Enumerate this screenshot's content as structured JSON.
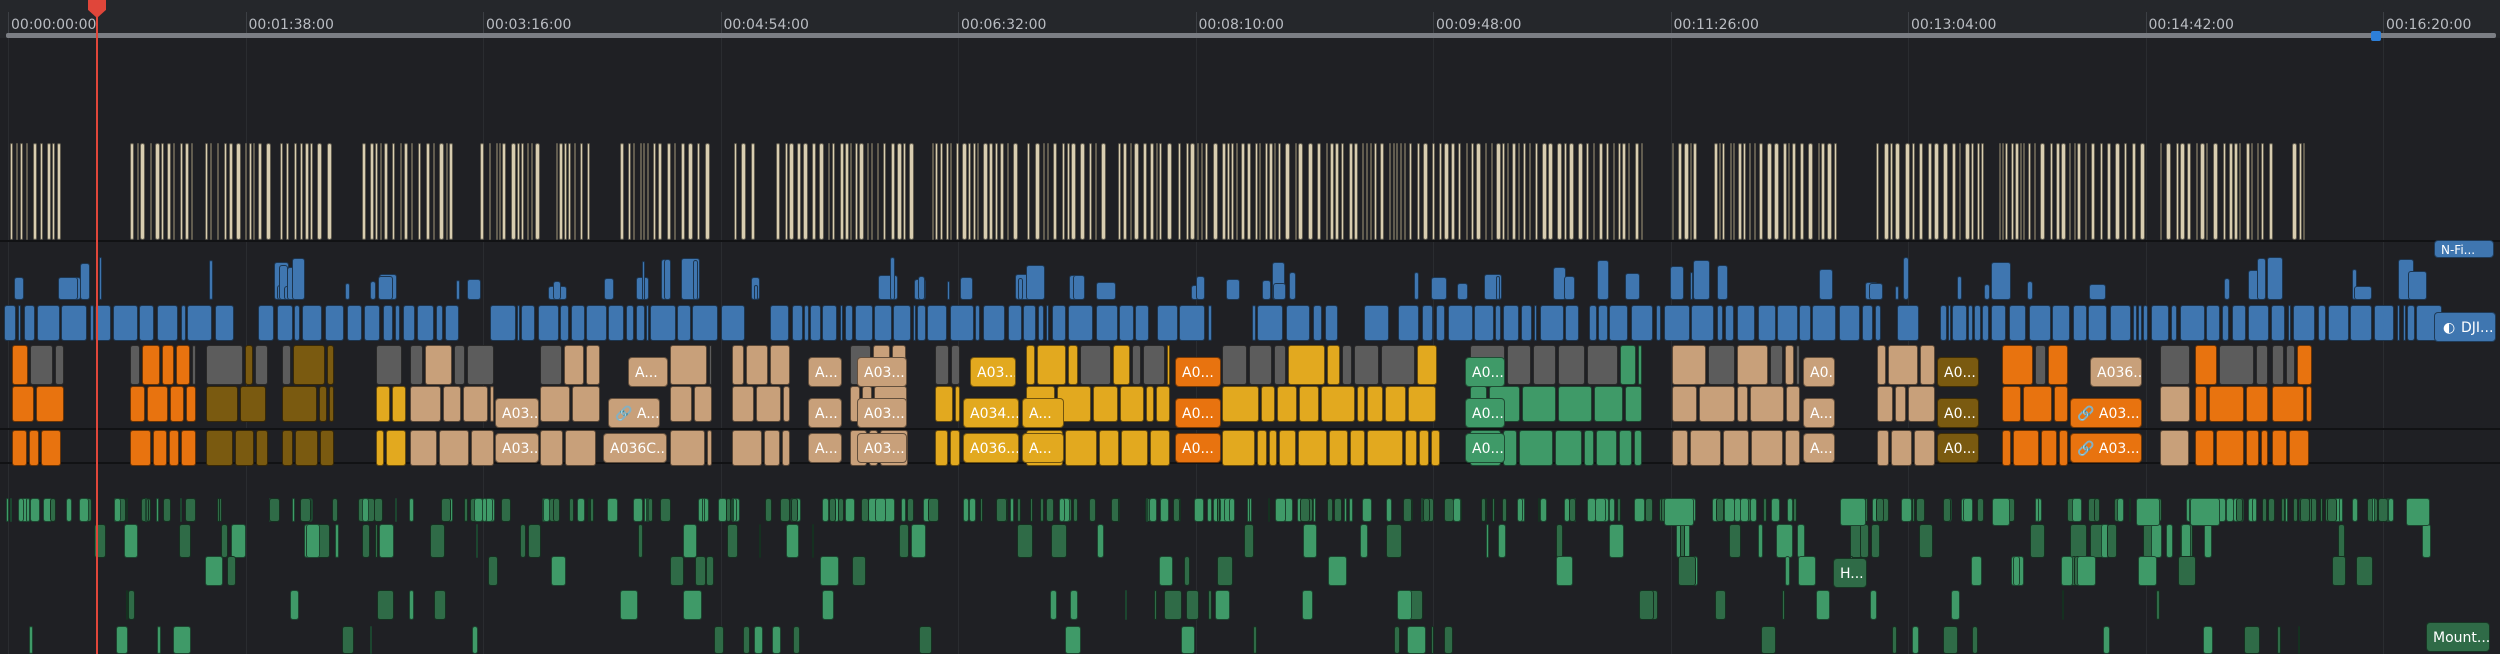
{
  "timecodes": [
    "00:00:00:00",
    "00:01:38:00",
    "00:03:16:00",
    "00:04:54:00",
    "00:06:32:00",
    "00:08:10:00",
    "00:09:48:00",
    "00:11:26:00",
    "00:13:04:00",
    "00:14:42:00",
    "00:16:20:00"
  ],
  "colors": {
    "cream": "#d8cdb0",
    "blue": "#3f76b0",
    "tan": "#c8a07a",
    "orange": "#e8730f",
    "yellow": "#e2a91f",
    "olive": "#7a5a10",
    "green": "#3f9a68",
    "darkgreen": "#2f6b47",
    "gray": "#5c5c5c",
    "playhead": "#e0463a"
  },
  "labels": {
    "v_right_top": "N-Fi...",
    "v_right_dji": "DJI...",
    "a1": "A...",
    "a2": "A...",
    "a3": "A03...",
    "a4": "A03...",
    "a5": "A0...",
    "a6": "A0...",
    "a7": "A0...",
    "a8": "A0...",
    "a9": "A036...",
    "b1": "A03...",
    "b2": "A...",
    "b3": "A...",
    "b4": "A03...",
    "b5": "A034...",
    "b6": "A...",
    "b7": "A0...",
    "b8": "A0...",
    "b9": "A...",
    "b10": "A0...",
    "b11": "A03...",
    "c1": "A03...",
    "c2": "A036C...",
    "c3": "A...",
    "c4": "A03...",
    "c5": "A036...",
    "c6": "A...",
    "c7": "A0...",
    "c8": "A0...",
    "c9": "A...",
    "c10": "A0...",
    "c11": "A03...",
    "h1": "H...",
    "m1": "Mount..."
  }
}
